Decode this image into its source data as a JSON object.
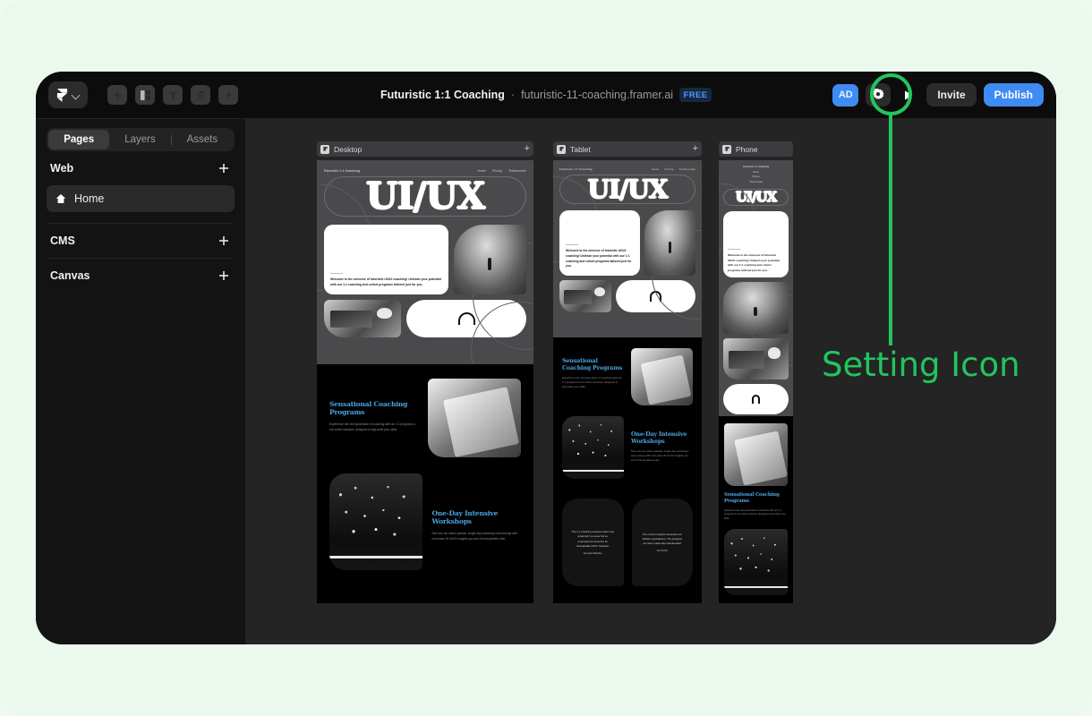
{
  "window": {
    "topbar": {
      "logo_icon": "framer-logo-icon",
      "logo_chevron_icon": "chevron-down-icon",
      "tools": [
        {
          "name": "insert-button",
          "icon": "plus-icon"
        },
        {
          "name": "layout-button",
          "icon": "layout-panels-icon"
        },
        {
          "name": "text-button",
          "icon": "text-t-icon"
        },
        {
          "name": "cms-button",
          "icon": "database-stack-icon"
        },
        {
          "name": "effects-button",
          "icon": "lightning-bolt-icon"
        }
      ],
      "doc_title": "Futuristic 1:1 Coaching",
      "separator": "·",
      "doc_url": "futuristic-11-coaching.framer.ai",
      "plan_badge": "FREE",
      "avatar_initials": "AD",
      "settings_icon": "gear-icon",
      "preview_icon": "play-icon",
      "invite_label": "Invite",
      "publish_label": "Publish"
    },
    "sidebar": {
      "tabs": [
        {
          "label": "Pages",
          "active": true
        },
        {
          "label": "Layers",
          "active": false
        },
        {
          "label": "Assets",
          "active": false
        }
      ],
      "sections": [
        {
          "title": "Web",
          "add_icon": "plus-icon"
        },
        {
          "title": "CMS",
          "add_icon": "plus-icon"
        },
        {
          "title": "Canvas",
          "add_icon": "plus-icon"
        }
      ],
      "pages": [
        {
          "label": "Home",
          "icon": "home-icon",
          "selected": true
        }
      ]
    },
    "canvas": {
      "breakpoints": [
        {
          "label": "Desktop",
          "icon": "breakpoint-flag-icon",
          "has_add": true
        },
        {
          "label": "Tablet",
          "icon": "breakpoint-flag-icon",
          "has_add": true
        },
        {
          "label": "Phone",
          "icon": "breakpoint-flag-icon",
          "has_add": false
        }
      ],
      "site": {
        "brand": "Futuristic 1:1 Coaching",
        "nav": [
          "Home",
          "Pricing",
          "Testimonials"
        ],
        "hero_title": "UI/UX",
        "hero_copy": "Welcome to the universe of futuristic UI/UX coaching! Unleash your potential with our 1:1 coaching and cohort programs tailored just for you.",
        "section_1_title": "Sensational Coaching Programs",
        "section_1_copy": "Experience the next generation of coaching with our 1:1 programs & our cohort sessions, designed to skyrocket your skills.",
        "section_2_title": "One-Day Intensive Workshops",
        "section_2_copy": "Dive into our action-packed, single-day workshops and emerge with more than 20 UI/UX insights you won't find anywhere else.",
        "testimonials": [
          {
            "quote": "The 1:1 coaching sessions were truly amazing! I've never felt so empowered to become an unstoppable UI/UX designer.",
            "author": "Georgia Rawlins"
          },
          {
            "quote": "The cohort program exceeded our wildest expectations. The progress our team made was unbelievable!",
            "author": "Tech Elite"
          }
        ]
      }
    }
  },
  "annotation": {
    "label": "Setting Icon",
    "color": "#22c55e",
    "target": "gear-icon"
  },
  "colors": {
    "page_bg": "#eaf8ee",
    "window_bg": "#0c0c0c",
    "sidebar_bg": "#131313",
    "canvas_bg": "#242424",
    "accent_blue": "#3f8bf4",
    "annotation_green": "#22c55e",
    "site_heading_blue": "#4aa3e0"
  }
}
